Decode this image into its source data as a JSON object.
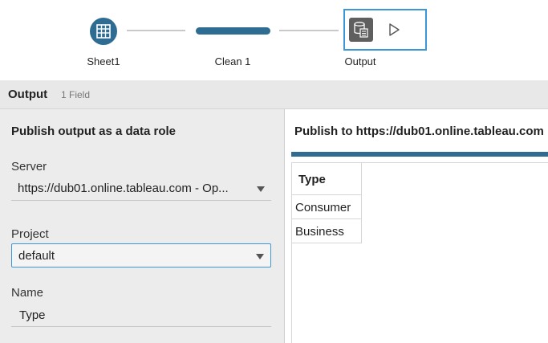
{
  "flow": {
    "nodes": [
      {
        "label": "Sheet1",
        "icon": "table-icon"
      },
      {
        "label": "Clean 1",
        "icon": "clean-step"
      },
      {
        "label": "Output",
        "icon": "database-icon",
        "action_icon": "play-icon"
      }
    ]
  },
  "output_header": {
    "title": "Output",
    "subtitle": "1 Field"
  },
  "left_panel": {
    "heading": "Publish output as a data role",
    "server": {
      "label": "Server",
      "value": "https://dub01.online.tableau.com - Op..."
    },
    "project": {
      "label": "Project",
      "value": "default"
    },
    "name": {
      "label": "Name",
      "value": "Type"
    }
  },
  "right_panel": {
    "heading": "Publish to https://dub01.online.tableau.com",
    "table": {
      "column": "Type",
      "rows": [
        "Consumer",
        "Business"
      ]
    }
  },
  "colors": {
    "accent": "#2e6c91",
    "focus": "#3d97d6"
  }
}
